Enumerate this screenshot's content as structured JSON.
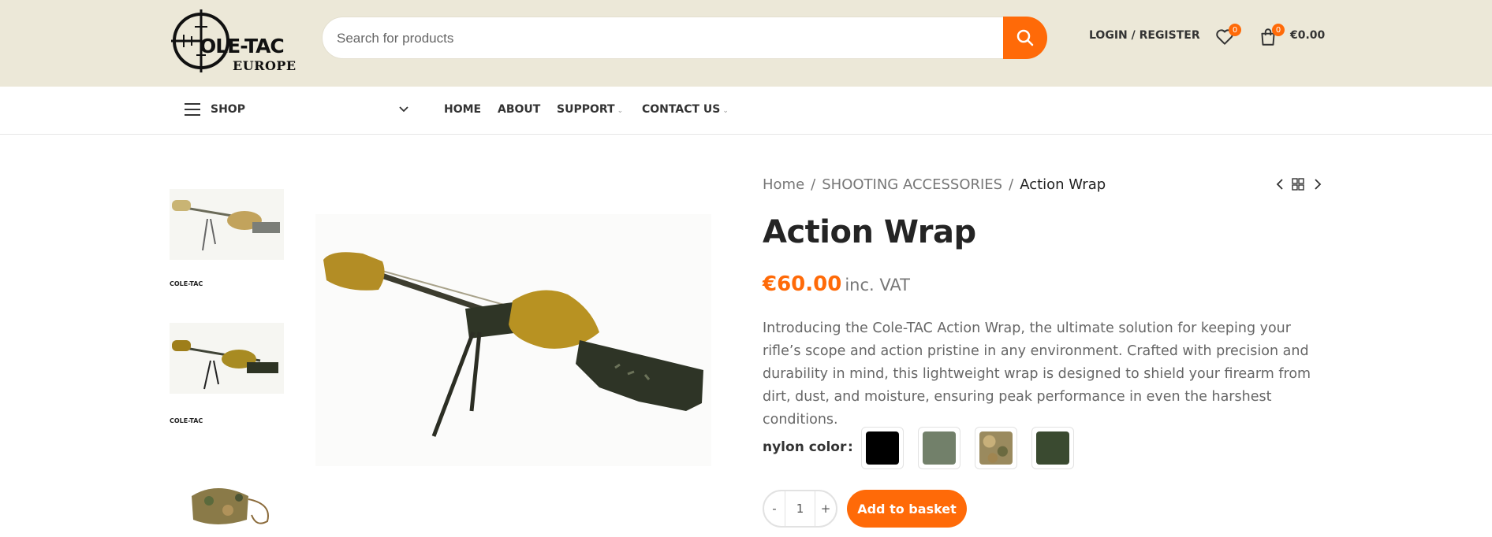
{
  "brand": {
    "logo_main": "OLE-TAC",
    "logo_sub": "EUROPE"
  },
  "search": {
    "placeholder": "Search for products"
  },
  "header": {
    "login_label": "LOGIN / REGISTER",
    "wishlist_count": "0",
    "cart_count": "0",
    "cart_total": "€0.00"
  },
  "nav": {
    "shop_label": "SHOP",
    "items": [
      {
        "label": "HOME",
        "has_dropdown": false
      },
      {
        "label": "ABOUT",
        "has_dropdown": false
      },
      {
        "label": "SUPPORT",
        "has_dropdown": true
      },
      {
        "label": "CONTACT US",
        "has_dropdown": true
      }
    ]
  },
  "gallery": {
    "thumb_logo_text": "COLE-TAC"
  },
  "breadcrumb": {
    "home": "Home",
    "category": "SHOOTING ACCESSORIES",
    "current": "Action Wrap",
    "separator": "/"
  },
  "product": {
    "title": "Action Wrap",
    "price": "€60.00",
    "price_suffix": "inc. VAT",
    "description": "Introducing the Cole-TAC Action Wrap, the ultimate solution for keeping your rifle’s scope and action pristine in any environment. Crafted with precision and durability in mind, this lightweight wrap is designed to shield your firearm from dirt, dust, and moisture, ensuring peak performance in even the harshest conditions.",
    "swatch_label": "nylon color",
    "swatches": [
      {
        "name": "black",
        "color": "#000000"
      },
      {
        "name": "green-grey",
        "color": "#72806a"
      },
      {
        "name": "multicam",
        "color": "#9a8a5e"
      },
      {
        "name": "dark-green",
        "color": "#3a4a30"
      }
    ],
    "quantity": "1",
    "minus_label": "-",
    "plus_label": "+",
    "add_to_basket": "Add to basket"
  },
  "colors": {
    "accent": "#ff6a08",
    "header_bg": "#ece8d8"
  }
}
